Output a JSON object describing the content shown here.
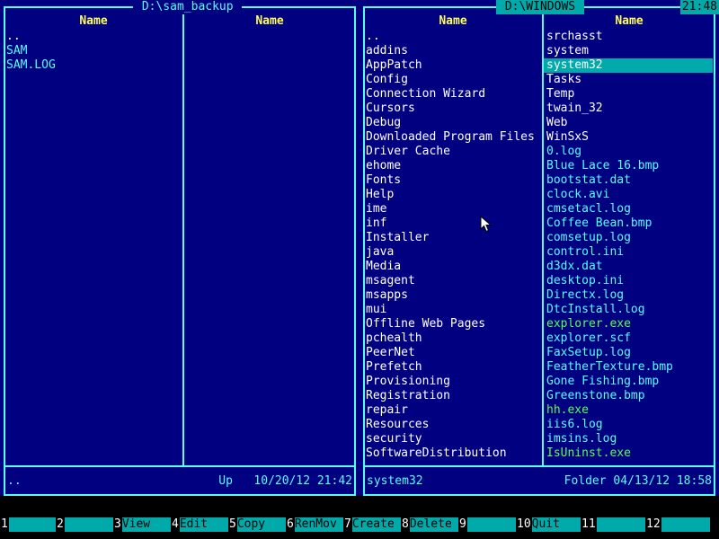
{
  "left_panel": {
    "title": " D:\\sam_backup ",
    "col1_header": "Name",
    "col2_header": "Name",
    "files_col1": [
      {
        "name": "..",
        "type": "dir"
      },
      {
        "name": "SAM",
        "type": "file"
      },
      {
        "name": "SAM.LOG",
        "type": "file"
      }
    ],
    "files_col2": [],
    "status_name": "..",
    "status_info": "Up   10/20/12 21:42"
  },
  "right_panel": {
    "title": " D:\\WINDOWS ",
    "clock": "21:48",
    "col1_header": "Name",
    "col2_header": "Name",
    "files_col1": [
      {
        "name": "..",
        "type": "dir"
      },
      {
        "name": "addins",
        "type": "dir"
      },
      {
        "name": "AppPatch",
        "type": "dir"
      },
      {
        "name": "Config",
        "type": "dir"
      },
      {
        "name": "Connection Wizard",
        "type": "dir"
      },
      {
        "name": "Cursors",
        "type": "dir"
      },
      {
        "name": "Debug",
        "type": "dir"
      },
      {
        "name": "Downloaded Program Files",
        "type": "dir"
      },
      {
        "name": "Driver Cache",
        "type": "dir"
      },
      {
        "name": "ehome",
        "type": "dir"
      },
      {
        "name": "Fonts",
        "type": "dir"
      },
      {
        "name": "Help",
        "type": "dir"
      },
      {
        "name": "ime",
        "type": "dir"
      },
      {
        "name": "inf",
        "type": "dir"
      },
      {
        "name": "Installer",
        "type": "dir"
      },
      {
        "name": "java",
        "type": "dir"
      },
      {
        "name": "Media",
        "type": "dir"
      },
      {
        "name": "msagent",
        "type": "dir"
      },
      {
        "name": "msapps",
        "type": "dir"
      },
      {
        "name": "mui",
        "type": "dir"
      },
      {
        "name": "Offline Web Pages",
        "type": "dir"
      },
      {
        "name": "pchealth",
        "type": "dir"
      },
      {
        "name": "PeerNet",
        "type": "dir"
      },
      {
        "name": "Prefetch",
        "type": "dir"
      },
      {
        "name": "Provisioning",
        "type": "dir"
      },
      {
        "name": "Registration",
        "type": "dir"
      },
      {
        "name": "repair",
        "type": "dir"
      },
      {
        "name": "Resources",
        "type": "dir"
      },
      {
        "name": "security",
        "type": "dir"
      },
      {
        "name": "SoftwareDistribution",
        "type": "dir"
      }
    ],
    "files_col2": [
      {
        "name": "srchasst",
        "type": "dir"
      },
      {
        "name": "system",
        "type": "dir"
      },
      {
        "name": "system32",
        "type": "sel"
      },
      {
        "name": "Tasks",
        "type": "dir"
      },
      {
        "name": "Temp",
        "type": "dir"
      },
      {
        "name": "twain_32",
        "type": "dir"
      },
      {
        "name": "Web",
        "type": "dir"
      },
      {
        "name": "WinSxS",
        "type": "dir"
      },
      {
        "name": "0.log",
        "type": "file"
      },
      {
        "name": "Blue Lace 16.bmp",
        "type": "file"
      },
      {
        "name": "bootstat.dat",
        "type": "file"
      },
      {
        "name": "clock.avi",
        "type": "file"
      },
      {
        "name": "cmsetacl.log",
        "type": "file"
      },
      {
        "name": "Coffee Bean.bmp",
        "type": "file"
      },
      {
        "name": "comsetup.log",
        "type": "file"
      },
      {
        "name": "control.ini",
        "type": "file"
      },
      {
        "name": "d3dx.dat",
        "type": "file"
      },
      {
        "name": "desktop.ini",
        "type": "file"
      },
      {
        "name": "Directx.log",
        "type": "file"
      },
      {
        "name": "DtcInstall.log",
        "type": "file"
      },
      {
        "name": "explorer.exe",
        "type": "exe"
      },
      {
        "name": "explorer.scf",
        "type": "file"
      },
      {
        "name": "FaxSetup.log",
        "type": "file"
      },
      {
        "name": "FeatherTexture.bmp",
        "type": "file"
      },
      {
        "name": "Gone Fishing.bmp",
        "type": "file"
      },
      {
        "name": "Greenstone.bmp",
        "type": "file"
      },
      {
        "name": "hh.exe",
        "type": "exe"
      },
      {
        "name": "iis6.log",
        "type": "file"
      },
      {
        "name": "imsins.log",
        "type": "file"
      },
      {
        "name": "IsUninst.exe",
        "type": "exe"
      }
    ],
    "status_name": "system32",
    "status_info": "Folder 04/13/12 18:58"
  },
  "keybar": [
    {
      "num": "1",
      "label": ""
    },
    {
      "num": "2",
      "label": ""
    },
    {
      "num": "3",
      "label": "View"
    },
    {
      "num": "4",
      "label": "Edit"
    },
    {
      "num": "5",
      "label": "Copy"
    },
    {
      "num": "6",
      "label": "RenMov"
    },
    {
      "num": "7",
      "label": "Create"
    },
    {
      "num": "8",
      "label": "Delete"
    },
    {
      "num": "9",
      "label": ""
    },
    {
      "num": "10",
      "label": "Quit"
    },
    {
      "num": "11",
      "label": ""
    },
    {
      "num": "12",
      "label": ""
    }
  ],
  "colors": {
    "panel_bg": "#000080",
    "border": "#55ffff",
    "header": "#ffff55",
    "selection": "#00aaaa",
    "exe": "#55ff55"
  },
  "icons": {
    "pointer": "arrow-cursor-icon"
  }
}
